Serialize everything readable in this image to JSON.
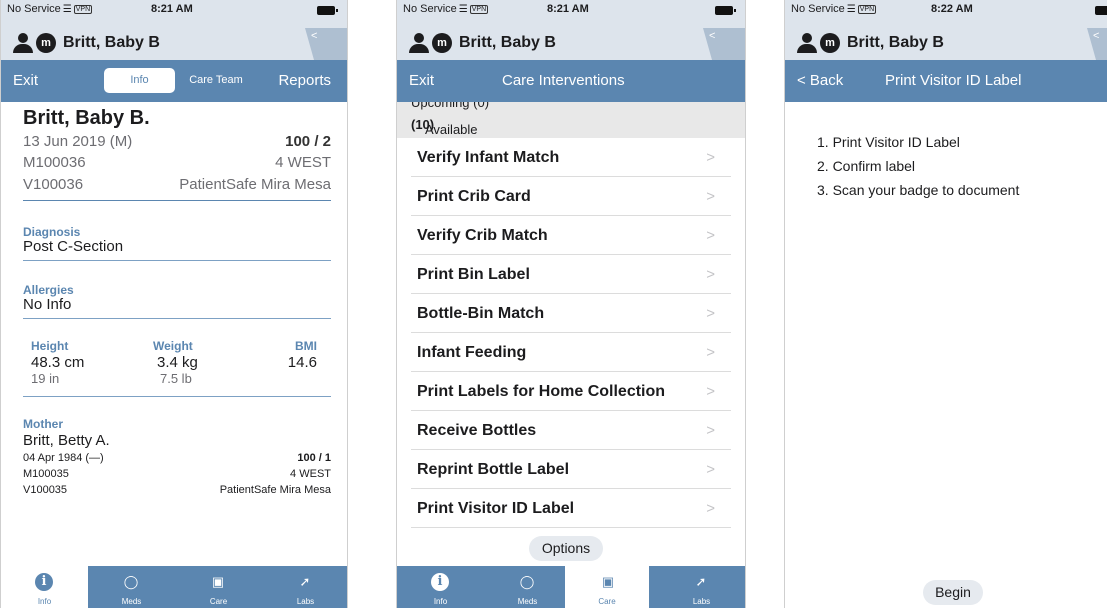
{
  "status": {
    "carrier": "No Service",
    "vpn": "VPN",
    "time1": "8:21 AM",
    "time2": "8:21 AM",
    "time3": "8:22 AM"
  },
  "patient": {
    "name": "Britt, Baby B",
    "badge": "m",
    "side_tab": "<"
  },
  "screen1": {
    "nav": {
      "exit": "Exit",
      "tab_info": "Info",
      "tab_care_team": "Care Team",
      "reports": "Reports"
    },
    "full_name": "Britt, Baby B.",
    "dob": "13 Jun 2019 (M)",
    "room": "100 / 2",
    "mrn": "M100036",
    "unit": "4 WEST",
    "visit": "V100036",
    "facility": "PatientSafe Mira Mesa",
    "diagnosis_label": "Diagnosis",
    "diagnosis": "Post C-Section",
    "allergies_label": "Allergies",
    "allergies": "No Info",
    "height_label": "Height",
    "height_cm": "48.3 cm",
    "height_in": "19 in",
    "weight_label": "Weight",
    "weight_kg": "3.4 kg",
    "weight_lb": "7.5 lb",
    "bmi_label": "BMI",
    "bmi": "14.6",
    "mother_label": "Mother",
    "mother_name": "Britt, Betty A.",
    "mother_dob": "04 Apr 1984 (—)",
    "mother_room": "100 / 1",
    "mother_mrn": "M100035",
    "mother_unit": "4 WEST",
    "mother_visit": "V100035",
    "mother_facility": "PatientSafe Mira Mesa"
  },
  "screen2": {
    "nav": {
      "exit": "Exit",
      "title": "Care Interventions"
    },
    "upcoming_peek": "Upcoming (0)",
    "section": "Available",
    "section_count": "(10)",
    "items": [
      "Verify Infant Match",
      "Print Crib Card",
      "Verify Crib Match",
      "Print Bin Label",
      "Bottle-Bin Match",
      "Infant Feeding",
      "Print Labels for Home Collection",
      "Receive Bottles",
      "Reprint Bottle Label",
      "Print Visitor ID Label"
    ],
    "chevron": ">",
    "options": "Options"
  },
  "screen3": {
    "nav": {
      "back": "< Back",
      "title": "Print Visitor ID Label"
    },
    "steps": [
      "1. Print Visitor ID Label",
      "2. Confirm label",
      "3. Scan your badge to document"
    ],
    "begin": "Begin"
  },
  "tabbar": {
    "items": [
      {
        "label": "Info",
        "icon": "info-icon"
      },
      {
        "label": "Meds",
        "icon": "pills-icon"
      },
      {
        "label": "Care",
        "icon": "clipboard-icon"
      },
      {
        "label": "Labs",
        "icon": "test-tube-icon"
      }
    ]
  },
  "colors": {
    "primary": "#5b86b0",
    "header_bg": "#dde4ec",
    "section_bg": "#e8e8e8"
  }
}
